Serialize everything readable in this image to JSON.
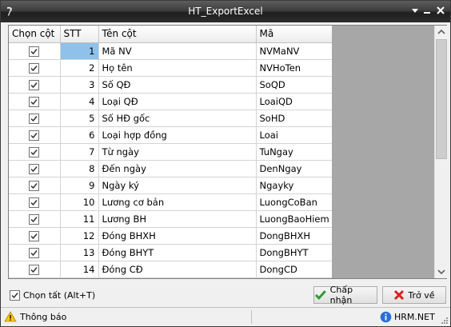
{
  "window": {
    "title": "HT_ExportExcel"
  },
  "columns": {
    "chon_cot": "Chọn cột",
    "stt": "STT",
    "ten_cot": "Tên cột",
    "ma": "Mã"
  },
  "rows": [
    {
      "checked": true,
      "stt": "1",
      "ten_cot": "Mã NV",
      "ma": "NVMaNV"
    },
    {
      "checked": true,
      "stt": "2",
      "ten_cot": "Họ tên",
      "ma": "NVHoTen"
    },
    {
      "checked": true,
      "stt": "3",
      "ten_cot": "Số QĐ",
      "ma": "SoQD"
    },
    {
      "checked": true,
      "stt": "4",
      "ten_cot": "Loại QĐ",
      "ma": "LoaiQD"
    },
    {
      "checked": true,
      "stt": "5",
      "ten_cot": "Số HĐ gốc",
      "ma": "SoHD"
    },
    {
      "checked": true,
      "stt": "6",
      "ten_cot": "Loại hợp đồng",
      "ma": "Loai"
    },
    {
      "checked": true,
      "stt": "7",
      "ten_cot": "Từ ngày",
      "ma": "TuNgay"
    },
    {
      "checked": true,
      "stt": "8",
      "ten_cot": "Đến ngày",
      "ma": "DenNgay"
    },
    {
      "checked": true,
      "stt": "9",
      "ten_cot": "Ngày ký",
      "ma": "Ngayky"
    },
    {
      "checked": true,
      "stt": "10",
      "ten_cot": "Lương cơ bản",
      "ma": "LuongCoBan"
    },
    {
      "checked": true,
      "stt": "11",
      "ten_cot": "Lương BH",
      "ma": "LuongBaoHiem"
    },
    {
      "checked": true,
      "stt": "12",
      "ten_cot": "Đóng BHXH",
      "ma": "DongBHXH"
    },
    {
      "checked": true,
      "stt": "13",
      "ten_cot": "Đóng BHYT",
      "ma": "DongBHYT"
    },
    {
      "checked": true,
      "stt": "14",
      "ten_cot": "Đóng CĐ",
      "ma": "DongCD"
    }
  ],
  "selected_row": 0,
  "footer": {
    "select_all_label": "Chọn tất (Alt+T)",
    "select_all_checked": true,
    "ok_label": "Chấp nhận",
    "back_label": "Trở về"
  },
  "status": {
    "left_text": "Thông báo",
    "right_text": "HRM.NET"
  },
  "colors": {
    "title_bar": "#2b2b2b",
    "selected_cell": "#8fc1ea",
    "grid_empty": "#a7a7a7"
  }
}
